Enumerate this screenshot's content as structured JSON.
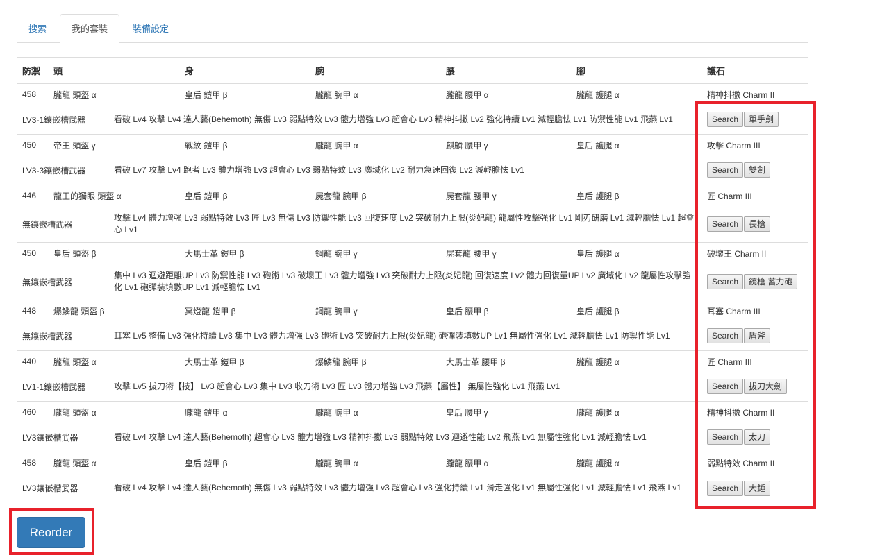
{
  "tabs": [
    {
      "label": "搜索",
      "active": false
    },
    {
      "label": "我的套裝",
      "active": true
    },
    {
      "label": "裝備設定",
      "active": false
    }
  ],
  "table": {
    "headers": [
      "防禦",
      "頭",
      "身",
      "腕",
      "腰",
      "腳",
      "護石"
    ],
    "sets": [
      {
        "defense": "458",
        "head": "朧龍 頭盔 α",
        "body": "皇后 鎧甲 β",
        "arm": "朧龍 腕甲 α",
        "waist": "朧龍 腰甲 α",
        "legs": "朧龍 護腿 α",
        "charm": "精神抖擻 Charm II",
        "weapon": "LV3-1鑲嵌槽武器",
        "skills": "看破 Lv4 攻擊 Lv4 達人藝(Behemoth) 無傷 Lv3 弱點特效 Lv3 體力增強 Lv3 超會心 Lv3 精神抖擻 Lv2 強化持續 Lv1 減輕膽怯 Lv1 防禦性能 Lv1 飛燕 Lv1",
        "search_label": "Search",
        "weapon_type": "單手劍"
      },
      {
        "defense": "450",
        "head": "帝王 頭盔 γ",
        "body": "戰紋 鎧甲 β",
        "arm": "朧龍 腕甲 α",
        "waist": "麒麟 腰甲 γ",
        "legs": "皇后 護腿 α",
        "charm": "攻擊 Charm III",
        "weapon": "LV3-3鑲嵌槽武器",
        "skills": "看破 Lv7 攻擊 Lv4 跑者 Lv3 體力增強 Lv3 超會心 Lv3 弱點特效 Lv3 廣域化 Lv2 耐力急速回復 Lv2 減輕膽怯 Lv1",
        "search_label": "Search",
        "weapon_type": "雙劍"
      },
      {
        "defense": "446",
        "head": "龍王的獨眼 頭盔 α",
        "body": "皇后 鎧甲 β",
        "arm": "屍套龍 腕甲 β",
        "waist": "屍套龍 腰甲 γ",
        "legs": "皇后 護腿 β",
        "charm": "匠 Charm III",
        "weapon": "無鑲嵌槽武器",
        "skills": "攻擊 Lv4 體力增強 Lv3 弱點特效 Lv3 匠 Lv3 無傷 Lv3 防禦性能 Lv3 回復速度 Lv2 突破耐力上限(炎妃龍) 龍屬性攻擊強化 Lv1 剛刃研磨 Lv1 減輕膽怯 Lv1 超會心 Lv1",
        "search_label": "Search",
        "weapon_type": "長槍"
      },
      {
        "defense": "450",
        "head": "皇后 頭盔 β",
        "body": "大馬士革 鎧甲 β",
        "arm": "鋼龍 腕甲 γ",
        "waist": "屍套龍 腰甲 γ",
        "legs": "皇后 護腿 α",
        "charm": "破壞王 Charm II",
        "weapon": "無鑲嵌槽武器",
        "skills": "集中 Lv3 迴避距離UP Lv3 防禦性能 Lv3 砲術 Lv3 破壞王 Lv3 體力增強 Lv3 突破耐力上限(炎妃龍) 回復速度 Lv2 體力回復量UP Lv2 廣域化 Lv2 龍屬性攻擊強化 Lv1 砲彈裝填數UP Lv1 減輕膽怯 Lv1",
        "search_label": "Search",
        "weapon_type": "銃槍 蓄力砲"
      },
      {
        "defense": "448",
        "head": "爆鱗龍 頭盔 β",
        "body": "冥燈龍 鎧甲 β",
        "arm": "鋼龍 腕甲 γ",
        "waist": "皇后 腰甲 β",
        "legs": "皇后 護腿 β",
        "charm": "耳塞 Charm III",
        "weapon": "無鑲嵌槽武器",
        "skills": "耳塞 Lv5 整備 Lv3 強化持續 Lv3 集中 Lv3 體力增強 Lv3 砲術 Lv3 突破耐力上限(炎妃龍) 砲彈裝填數UP Lv1 無屬性強化 Lv1 減輕膽怯 Lv1 防禦性能 Lv1",
        "search_label": "Search",
        "weapon_type": "盾斧"
      },
      {
        "defense": "440",
        "head": "朧龍 頭盔 α",
        "body": "大馬士革 鎧甲 β",
        "arm": "爆鱗龍 腕甲 β",
        "waist": "大馬士革 腰甲 β",
        "legs": "朧龍 護腿 α",
        "charm": "匠 Charm III",
        "weapon": "LV1-1鑲嵌槽武器",
        "skills": "攻擊 Lv5 拔刀術【技】 Lv3 超會心 Lv3 集中 Lv3 收刀術 Lv3 匠 Lv3 體力增強 Lv3 飛燕【屬性】 無屬性強化 Lv1 飛燕 Lv1",
        "search_label": "Search",
        "weapon_type": "拔刀大劍"
      },
      {
        "defense": "460",
        "head": "朧龍 頭盔 α",
        "body": "朧龍 鎧甲 α",
        "arm": "朧龍 腕甲 α",
        "waist": "皇后 腰甲 γ",
        "legs": "朧龍 護腿 α",
        "charm": "精神抖擻 Charm II",
        "weapon": "LV3鑲嵌槽武器",
        "skills": "看破 Lv4 攻擊 Lv4 達人藝(Behemoth) 超會心 Lv3 體力增強 Lv3 精神抖擻 Lv3 弱點特效 Lv3 迴避性能 Lv2 飛燕 Lv1 無屬性強化 Lv1 減輕膽怯 Lv1",
        "search_label": "Search",
        "weapon_type": "太刀"
      },
      {
        "defense": "458",
        "head": "朧龍 頭盔 α",
        "body": "皇后 鎧甲 β",
        "arm": "朧龍 腕甲 α",
        "waist": "朧龍 腰甲 α",
        "legs": "朧龍 護腿 α",
        "charm": "弱點特效 Charm II",
        "weapon": "LV3鑲嵌槽武器",
        "skills": "看破 Lv4 攻擊 Lv4 達人藝(Behemoth) 無傷 Lv3 弱點特效 Lv3 體力增強 Lv3 超會心 Lv3 強化持續 Lv1 滑走強化 Lv1 無屬性強化 Lv1 減輕膽怯 Lv1 飛燕 Lv1",
        "search_label": "Search",
        "weapon_type": "大錘"
      }
    ]
  },
  "reorder_label": "Reorder",
  "highlight_color": "#e8212b",
  "primary_color": "#337ab7"
}
